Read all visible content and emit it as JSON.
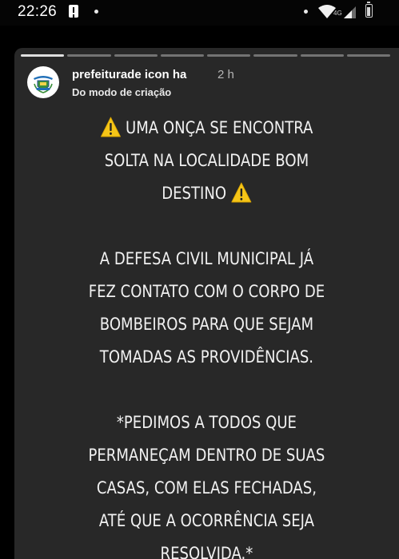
{
  "status_bar": {
    "time": "22:26",
    "network_label": "4G",
    "icons": [
      "notification-icon",
      "dot-icon",
      "dot-icon",
      "wifi-icon",
      "signal-icon",
      "battery-icon"
    ]
  },
  "story": {
    "account_name": "prefeiturade icon ha",
    "time_ago": "2 h",
    "subtitle": "Do modo de criação",
    "progress_segments": 8,
    "progress_done": 1,
    "message": {
      "p1_line1": "UMA ONÇA SE ENCONTRA",
      "p1_line2": "SOLTA NA LOCALIDADE BOM",
      "p1_line3": "DESTINO",
      "p2_line1": "A DEFESA CIVIL MUNICIPAL JÁ",
      "p2_line2": "FEZ CONTATO COM O CORPO DE",
      "p2_line3": "BOMBEIROS PARA QUE SEJAM",
      "p2_line4": "TOMADAS AS PROVIDÊNCIAS.",
      "p3_line1": "*PEDIMOS A TODOS QUE",
      "p3_line2": "PERMANEÇAM DENTRO DE SUAS",
      "p3_line3": "CASAS, COM ELAS FECHADAS,",
      "p3_line4": "ATÉ QUE A OCORRÊNCIA SEJA",
      "p3_line5": "RESOLVIDA.*"
    },
    "emoji": "warning-icon"
  },
  "colors": {
    "background": "#000000",
    "card": "#282828",
    "text": "#f1f1f1",
    "warning_yellow": "#f5c518"
  }
}
